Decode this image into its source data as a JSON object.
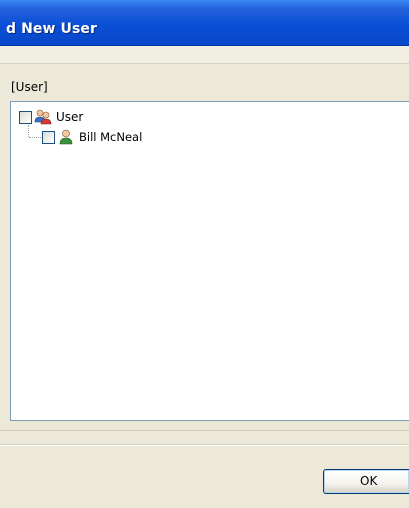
{
  "window": {
    "title": "d New User"
  },
  "group": {
    "label": "[User]"
  },
  "tree": {
    "root": {
      "label": "User",
      "checked": false,
      "icon": "user-group-icon"
    },
    "children": [
      {
        "label": "Bill McNeal",
        "checked": false,
        "icon": "user-icon"
      }
    ]
  },
  "buttons": {
    "ok_label": "OK"
  }
}
